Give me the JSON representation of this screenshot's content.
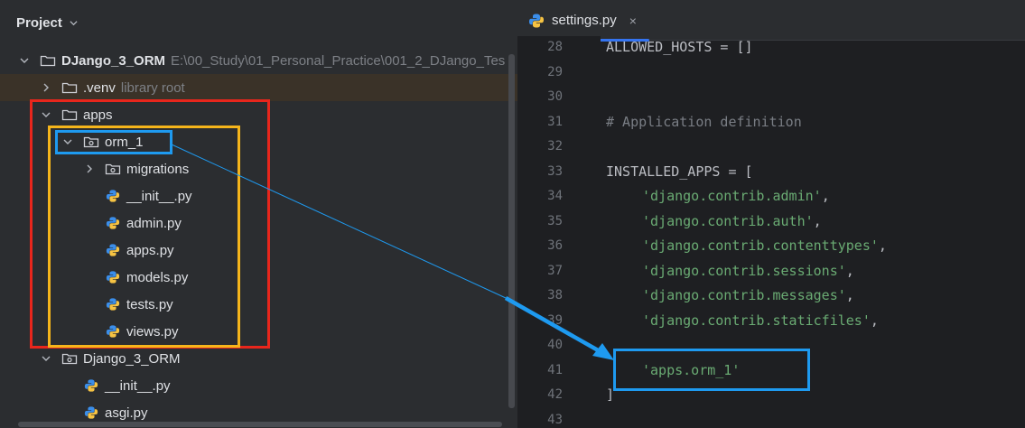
{
  "panel": {
    "title": "Project"
  },
  "tree": [
    {
      "label": "DJango_3_ORM",
      "hint": "E:\\00_Study\\01_Personal_Practice\\001_2_DJango_Tes",
      "bold": true
    },
    {
      "label": ".venv",
      "hint": "library root"
    },
    {
      "label": "apps"
    },
    {
      "label": "orm_1"
    },
    {
      "label": "migrations"
    },
    {
      "label": "__init__.py"
    },
    {
      "label": "admin.py"
    },
    {
      "label": "apps.py"
    },
    {
      "label": "models.py"
    },
    {
      "label": "tests.py"
    },
    {
      "label": "views.py"
    },
    {
      "label": "Django_3_ORM"
    },
    {
      "label": "__init__.py"
    },
    {
      "label": "asgi.py"
    }
  ],
  "editor": {
    "tab_label": "settings.py",
    "tab_close": "×",
    "lines": [
      {
        "num": "28",
        "text": "ALLOWED_HOSTS = []",
        "kind": "plain"
      },
      {
        "num": "29",
        "text": "",
        "kind": "plain"
      },
      {
        "num": "30",
        "text": "",
        "kind": "plain"
      },
      {
        "num": "31",
        "text": "# Application definition",
        "kind": "comment"
      },
      {
        "num": "32",
        "text": "",
        "kind": "plain"
      },
      {
        "num": "33",
        "text": "INSTALLED_APPS = [",
        "kind": "plain"
      },
      {
        "num": "34",
        "text": "'django.contrib.admin'",
        "kind": "str",
        "suffix": ","
      },
      {
        "num": "35",
        "text": "'django.contrib.auth'",
        "kind": "str",
        "suffix": ","
      },
      {
        "num": "36",
        "text": "'django.contrib.contenttypes'",
        "kind": "str",
        "suffix": ","
      },
      {
        "num": "37",
        "text": "'django.contrib.sessions'",
        "kind": "str",
        "suffix": ","
      },
      {
        "num": "38",
        "text": "'django.contrib.messages'",
        "kind": "str",
        "suffix": ","
      },
      {
        "num": "39",
        "text": "'django.contrib.staticfiles'",
        "kind": "str",
        "suffix": ","
      },
      {
        "num": "40",
        "text": "",
        "kind": "plain"
      },
      {
        "num": "41",
        "text": "'apps.orm_1'",
        "kind": "str",
        "suffix": ""
      },
      {
        "num": "42",
        "text": "]",
        "kind": "plain"
      },
      {
        "num": "43",
        "text": "",
        "kind": "plain"
      }
    ]
  },
  "colors": {
    "annotation_red": "#e8261c",
    "annotation_yellow": "#f5b51b",
    "annotation_blue": "#1e9af0",
    "string_green": "#6aab73",
    "comment_gray": "#7a7e85"
  },
  "icons": {
    "folder": "folder-icon",
    "package": "package-folder-icon",
    "python": "python-file-icon",
    "chevron_right": "chevron-right-icon",
    "chevron_down": "chevron-down-icon"
  }
}
